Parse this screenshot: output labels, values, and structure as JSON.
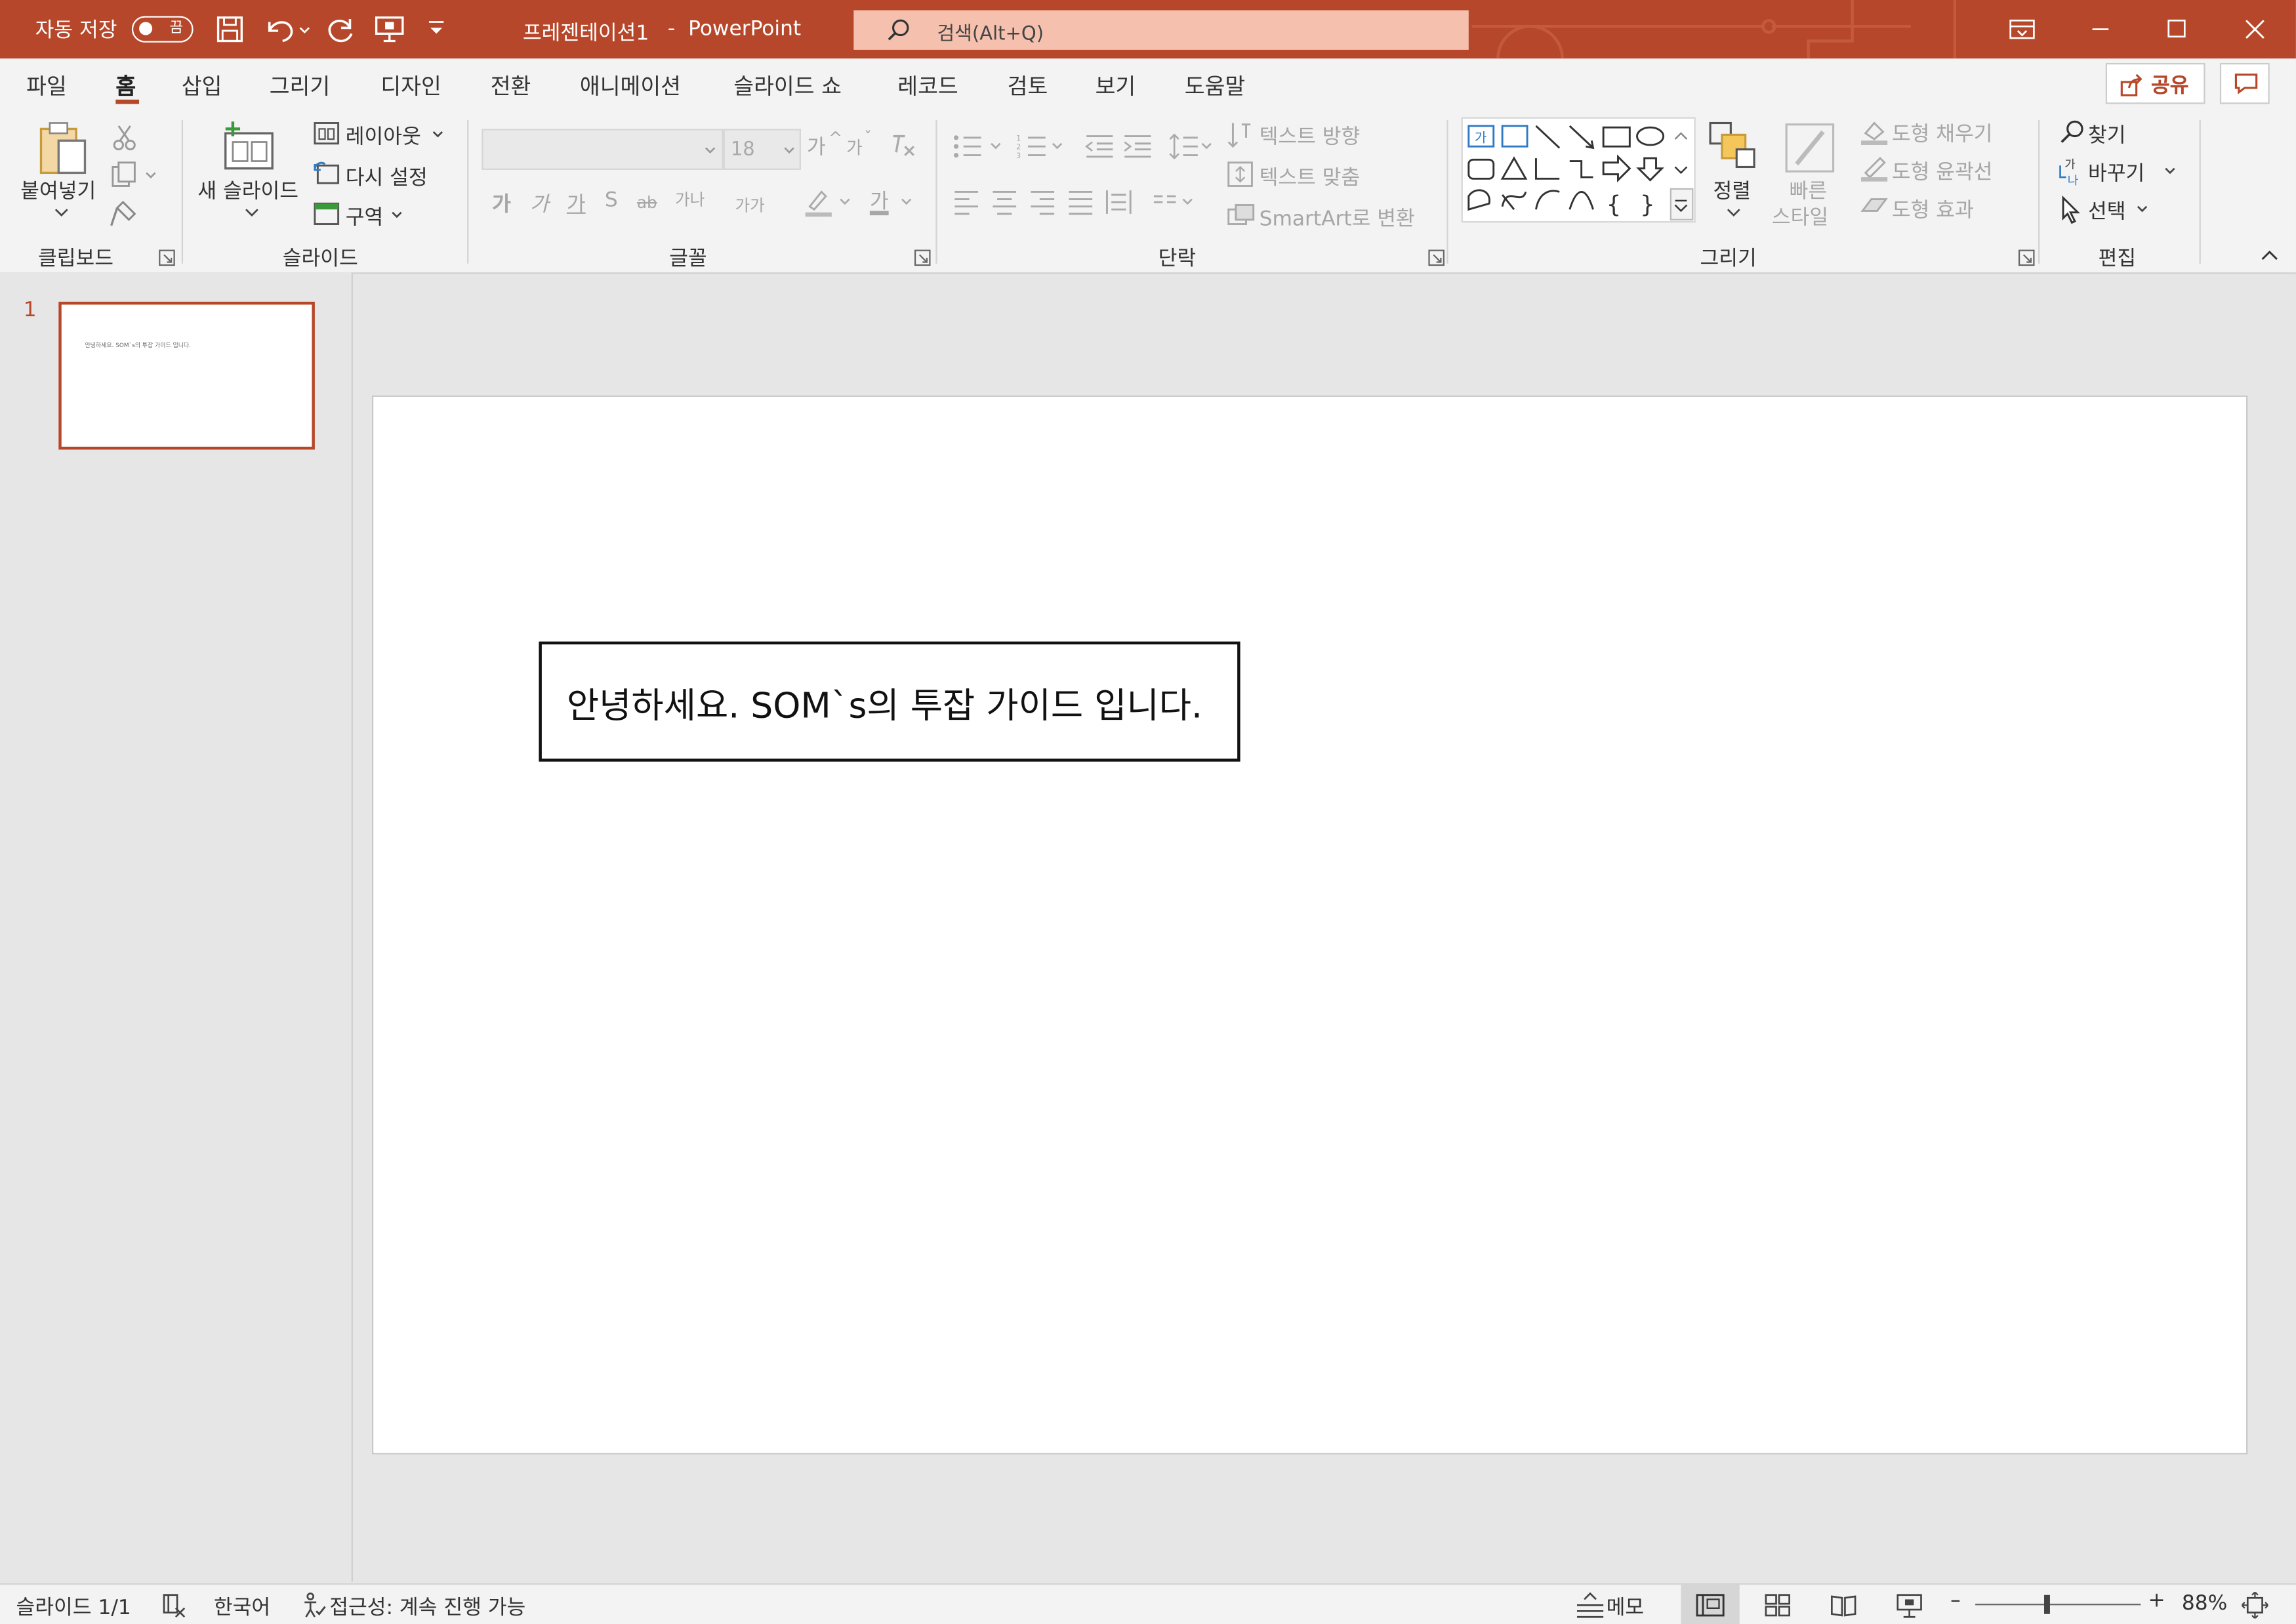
{
  "titlebar": {
    "autosave_label": "자동 저장",
    "autosave_state": "끔",
    "document_title": "프레젠테이션1",
    "title_separator": "-",
    "app_name": "PowerPoint",
    "search_placeholder": "검색(Alt+Q)",
    "accent_color": "#b7472a"
  },
  "menu": {
    "tabs": [
      "파일",
      "홈",
      "삽입",
      "그리기",
      "디자인",
      "전환",
      "애니메이션",
      "슬라이드 쇼",
      "레코드",
      "검토",
      "보기",
      "도움말"
    ],
    "active_tab": "홈",
    "share_label": "공유"
  },
  "ribbon": {
    "clipboard": {
      "paste": "붙여넣기",
      "group": "클립보드"
    },
    "slides": {
      "new_slide": "새 슬라이드",
      "layout": "레이아웃",
      "reset": "다시 설정",
      "section": "구역",
      "group": "슬라이드"
    },
    "font": {
      "font_name": "",
      "font_size": "18",
      "bold": "가",
      "italic": "가",
      "underline": "가",
      "shadow": "S",
      "strike": "ab",
      "spacing": "가나",
      "case": "가가",
      "font_color": "가",
      "grow": "가",
      "shrink": "가",
      "group": "글꼴"
    },
    "paragraph": {
      "text_direction": "텍스트 방향",
      "align_text": "텍스트 맞춤",
      "smartart": "SmartArt로 변환",
      "group": "단락"
    },
    "drawing": {
      "arrange": "정렬",
      "quick_styles_1": "빠른",
      "quick_styles_2": "스타일",
      "shape_fill": "도형 채우기",
      "shape_outline": "도형 윤곽선",
      "shape_effects": "도형 효과",
      "group": "그리기"
    },
    "editing": {
      "find": "찾기",
      "replace": "바꾸기",
      "select": "선택",
      "group": "편집"
    }
  },
  "thumbnails": {
    "slide_number": "1",
    "thumb_text": "안녕하세요. SOM`s의 투잡 가이드 입니다."
  },
  "slide": {
    "textbox_text": "안녕하세요. SOM`s의 투잡 가이드 입니다."
  },
  "statusbar": {
    "slide_info": "슬라이드 1/1",
    "language": "한국어",
    "accessibility": "접근성: 계속 진행 가능",
    "notes": "메모",
    "zoom": "88%",
    "zoom_level": 0.88
  }
}
